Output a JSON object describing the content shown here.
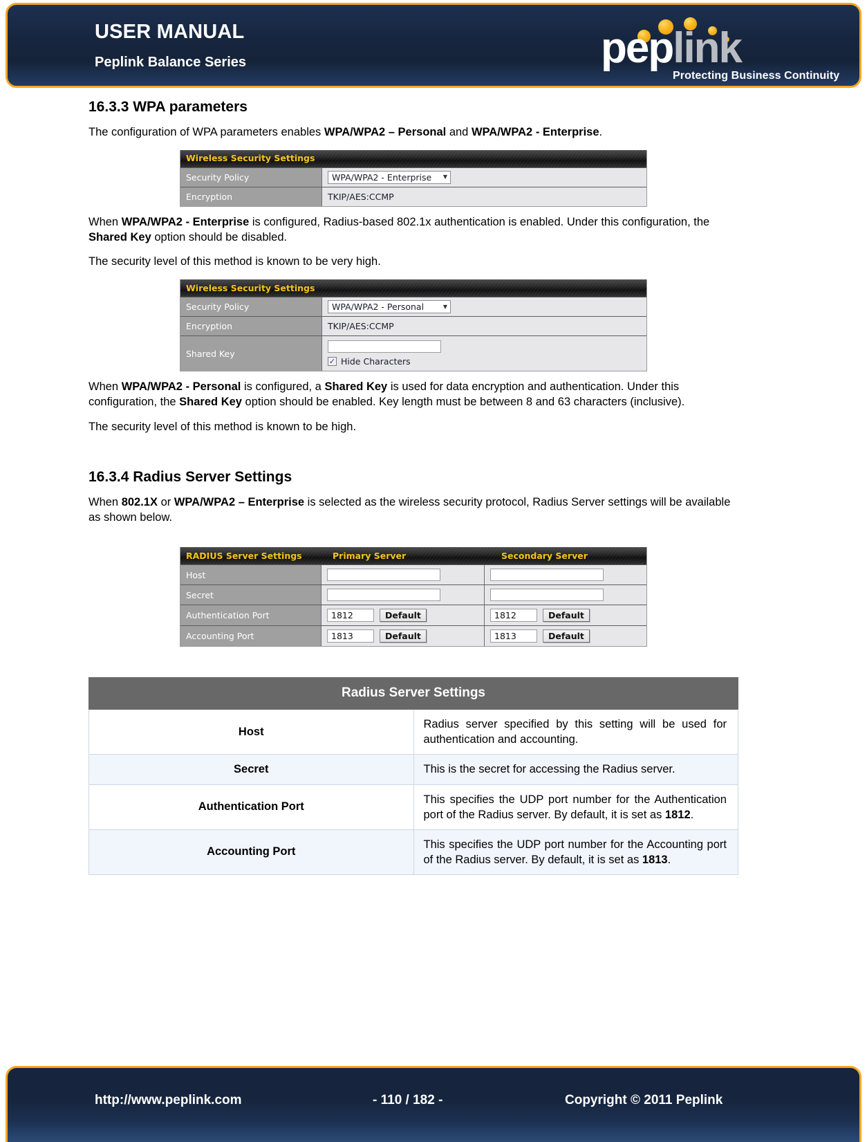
{
  "header": {
    "title": "USER MANUAL",
    "subtitle": "Peplink Balance Series",
    "logo": {
      "word_part1": "pep",
      "word_part2": "link",
      "tagline": "Protecting Business Continuity"
    },
    "accent_color": "#F5A623",
    "background_color": "#17263f"
  },
  "sections": {
    "wpa": {
      "heading": "16.3.3 WPA parameters",
      "intro_prefix": "The configuration of WPA parameters enables ",
      "intro_bold1": "WPA/WPA2 – Personal",
      "intro_mid": " and ",
      "intro_bold2": "WPA/WPA2 - Enterprise",
      "intro_suffix": ".",
      "enterprise_para_1": "When ",
      "enterprise_bold_1": "WPA/WPA2 - Enterprise",
      "enterprise_para_2": " is configured, Radius-based 802.1x authentication is enabled. Under this configuration, the ",
      "enterprise_bold_2": "Shared Key",
      "enterprise_para_3": " option should be disabled.",
      "enterprise_level": "The security level of this method is known to be very high.",
      "personal_para_1": "When ",
      "personal_bold_1": "WPA/WPA2 - Personal",
      "personal_para_2": " is configured, a ",
      "personal_bold_2": "Shared Key",
      "personal_para_3": " is used for data encryption and authentication.  Under this configuration, the ",
      "personal_bold_3": "Shared Key",
      "personal_para_4": " option should be enabled.  Key length must be between 8 and 63 characters (inclusive).",
      "personal_level": "The security level of this method is known to be high."
    },
    "radius": {
      "heading": "16.3.4 Radius Server Settings",
      "intro_prefix": "When ",
      "intro_bold1": "802.1X",
      "intro_mid": " or ",
      "intro_bold2": "WPA/WPA2 – Enterprise",
      "intro_suffix": " is selected as the wireless security protocol, Radius Server settings will be available as shown below."
    }
  },
  "screenshot_enterprise": {
    "title": "Wireless Security Settings",
    "rows": [
      {
        "label": "Security Policy",
        "value": "WPA/WPA2 - Enterprise",
        "type": "select"
      },
      {
        "label": "Encryption",
        "value": "TKIP/AES:CCMP",
        "type": "text"
      }
    ]
  },
  "screenshot_personal": {
    "title": "Wireless Security Settings",
    "rows": [
      {
        "label": "Security Policy",
        "value": "WPA/WPA2 - Personal",
        "type": "select"
      },
      {
        "label": "Encryption",
        "value": "TKIP/AES:CCMP",
        "type": "text"
      },
      {
        "label": "Shared Key",
        "value": "",
        "type": "input"
      }
    ],
    "hide_characters_label": "Hide Characters",
    "hide_characters_checked": "✓"
  },
  "screenshot_radius": {
    "col_title": "RADIUS Server Settings",
    "col_primary": "Primary Server",
    "col_secondary": "Secondary Server",
    "rows": [
      {
        "label": "Host",
        "primary": "",
        "secondary": "",
        "type": "input"
      },
      {
        "label": "Secret",
        "primary": "",
        "secondary": "",
        "type": "input"
      },
      {
        "label": "Authentication Port",
        "primary": "1812",
        "secondary": "1812",
        "type": "port",
        "button": "Default"
      },
      {
        "label": "Accounting Port",
        "primary": "1813",
        "secondary": "1813",
        "type": "port",
        "button": "Default"
      }
    ]
  },
  "desc_table": {
    "title": "Radius Server Settings",
    "rows": [
      {
        "key": "Host",
        "text": "Radius server specified by this setting will be used for authentication and accounting."
      },
      {
        "key": "Secret",
        "text": "This is the secret for accessing the Radius server."
      },
      {
        "key": "Authentication Port",
        "text_before": "This specifies the UDP port number for the Authentication port of the Radius server. By default, it is set as ",
        "text_bold": "1812",
        "text_after": "."
      },
      {
        "key": "Accounting Port",
        "text_before": "This specifies the UDP port number for the Accounting port of the Radius server. By default, it is set as ",
        "text_bold": "1813",
        "text_after": "."
      }
    ]
  },
  "footer": {
    "url": "http://www.peplink.com",
    "page": "- 110 / 182 -",
    "copyright": "Copyright © 2011 Peplink"
  }
}
